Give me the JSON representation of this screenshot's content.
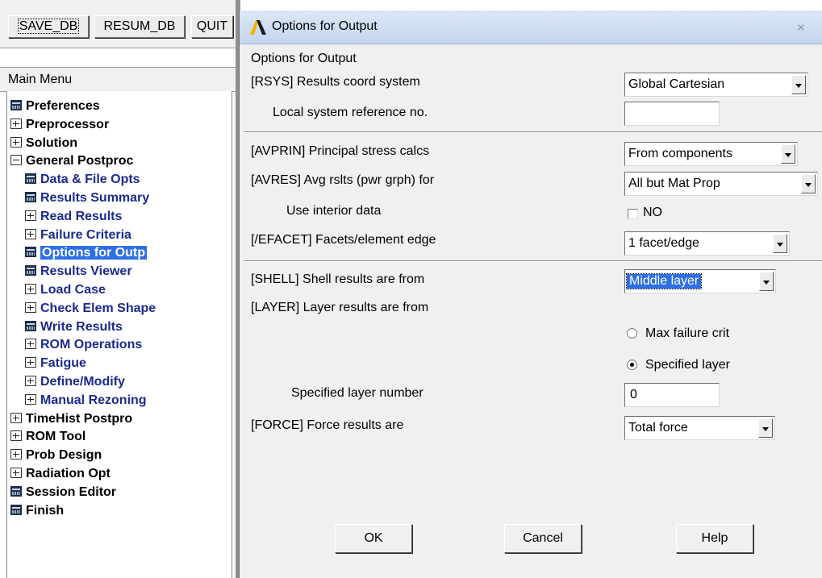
{
  "toolbar": {
    "save_db": "SAVE_DB",
    "resum_db": "RESUM_DB",
    "quit": "QUIT"
  },
  "main_menu": {
    "title": "Main Menu",
    "items": [
      {
        "label": "Preferences",
        "icon": "calc-icon",
        "sub": false
      },
      {
        "label": "Preprocessor",
        "icon": "expand-icon",
        "sub": false
      },
      {
        "label": "Solution",
        "icon": "expand-icon",
        "sub": false
      },
      {
        "label": "General Postproc",
        "icon": "collapse-icon",
        "sub": false
      },
      {
        "label": "Data & File Opts",
        "icon": "calc-icon",
        "sub": true
      },
      {
        "label": "Results Summary",
        "icon": "calc-icon",
        "sub": true
      },
      {
        "label": "Read Results",
        "icon": "expand-icon",
        "sub": true
      },
      {
        "label": "Failure Criteria",
        "icon": "expand-icon",
        "sub": true
      },
      {
        "label": "Options for Outp",
        "icon": "calc-icon",
        "sub": true,
        "selected": true
      },
      {
        "label": "Results Viewer",
        "icon": "calc-icon",
        "sub": true
      },
      {
        "label": "Load Case",
        "icon": "expand-icon",
        "sub": true
      },
      {
        "label": "Check Elem Shape",
        "icon": "expand-icon",
        "sub": true
      },
      {
        "label": "Write Results",
        "icon": "calc-icon",
        "sub": true
      },
      {
        "label": "ROM Operations",
        "icon": "expand-icon",
        "sub": true
      },
      {
        "label": "Fatigue",
        "icon": "expand-icon",
        "sub": true
      },
      {
        "label": "Define/Modify",
        "icon": "expand-icon",
        "sub": true
      },
      {
        "label": "Manual Rezoning",
        "icon": "expand-icon",
        "sub": true
      },
      {
        "label": "TimeHist Postpro",
        "icon": "expand-icon",
        "sub": false
      },
      {
        "label": "ROM Tool",
        "icon": "expand-icon",
        "sub": false
      },
      {
        "label": "Prob Design",
        "icon": "expand-icon",
        "sub": false
      },
      {
        "label": "Radiation Opt",
        "icon": "expand-icon",
        "sub": false
      },
      {
        "label": "Session Editor",
        "icon": "calc-icon",
        "sub": false
      },
      {
        "label": "Finish",
        "icon": "calc-icon",
        "sub": false
      }
    ]
  },
  "dialog": {
    "title": "Options for Output",
    "heading": "Options for Output",
    "rsys": {
      "label": "[RSYS]  Results coord system",
      "value": "Global Cartesian"
    },
    "local_ref": {
      "label": "Local system reference no.",
      "value": ""
    },
    "avprin": {
      "label": "[AVPRIN]  Principal stress calcs",
      "value": "From components"
    },
    "avres": {
      "label": "[AVRES]  Avg rslts (pwr grph) for",
      "value": "All but Mat Prop"
    },
    "interior": {
      "label": "Use interior data",
      "value": "NO"
    },
    "efacet": {
      "label": "[/EFACET]  Facets/element edge",
      "value": "1 facet/edge"
    },
    "shell": {
      "label": "[SHELL]  Shell results are from",
      "value": "Middle layer"
    },
    "layer": {
      "label": "[LAYER]  Layer results are from",
      "option_max": "Max failure crit",
      "option_specified": "Specified layer",
      "selected": "Specified layer"
    },
    "layer_number": {
      "label": "Specified layer number",
      "value": "0"
    },
    "force": {
      "label": "[FORCE]  Force results are",
      "value": "Total force"
    },
    "buttons": {
      "ok": "OK",
      "cancel": "Cancel",
      "help": "Help"
    },
    "close_glyph": "⨯"
  }
}
